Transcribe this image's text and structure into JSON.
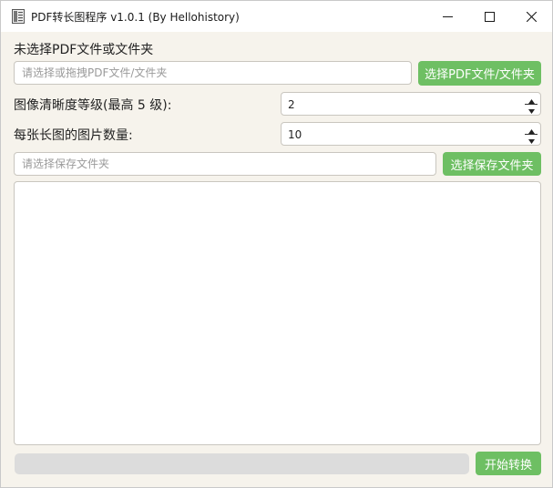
{
  "window": {
    "title": "PDF转长图程序 v1.0.1 (By Hellohistory)"
  },
  "source": {
    "status_label": "未选择PDF文件或文件夹",
    "input_placeholder": "请选择或拖拽PDF文件/文件夹",
    "input_value": "",
    "select_button": "选择PDF文件/文件夹"
  },
  "quality": {
    "label": "图像清晰度等级(最高 5 级):",
    "value": "2"
  },
  "images_per_long": {
    "label": "每张长图的图片数量:",
    "value": "10"
  },
  "output": {
    "input_placeholder": "请选择保存文件夹",
    "input_value": "",
    "select_button": "选择保存文件夹"
  },
  "log": {
    "text": ""
  },
  "progress": {
    "fraction": 0
  },
  "actions": {
    "start_button": "开始转换"
  },
  "colors": {
    "accent_green": "#6ebf63",
    "window_bg": "#f6f3ec",
    "progress_track": "#dcdcdc"
  },
  "icons": {
    "app": "document-icon",
    "minimize": "minimize-icon",
    "maximize": "maximize-icon",
    "close": "close-icon",
    "spin_up": "chevron-up-icon",
    "spin_down": "chevron-down-icon"
  }
}
